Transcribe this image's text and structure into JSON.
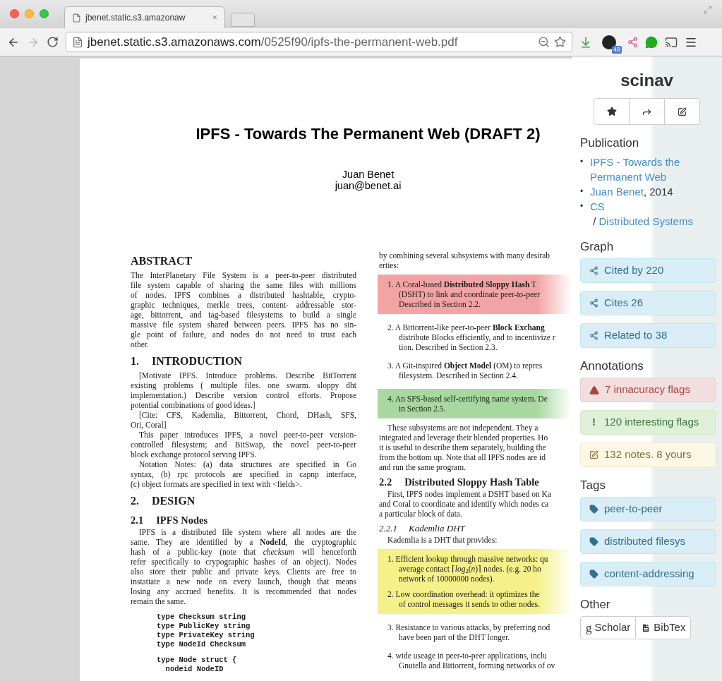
{
  "browser": {
    "tab_title": "jbenet.static.s3.amazonaw",
    "tab_close": "×",
    "url_host": "jbenet.static.s3.amazonaws.com",
    "url_path": "/0525f90/ipfs-the-permanent-web.pdf",
    "extension_badge": "49"
  },
  "document": {
    "title": "IPFS - Towards The Permanent Web (DRAFT 2)",
    "author": "Juan Benet",
    "email": "juan@benet.ai",
    "left_column": [
      {
        "kind": "heading",
        "text": "ABSTRACT"
      },
      {
        "kind": "paragraph",
        "indent": false,
        "lines": [
          "The InterPlanetary File System is a peer-to-peer distributed",
          "file system capable of sharing the same files with millions",
          "of nodes.  IPFS combines a distributed hashtable, crypto-",
          "graphic techniques, merkle trees, content- addressable stor-",
          "age, bittorrent, and tag-based filesystems to build a single",
          "massive file system shared between peers. IPFS has no sin-",
          "gle point of failure, and nodes do not need to trust each",
          "other."
        ]
      },
      {
        "kind": "heading",
        "number": "1.",
        "text": "INTRODUCTION"
      },
      {
        "kind": "paragraph",
        "indent": true,
        "lines": [
          "[Motivate IPFS. Introduce problems. Describe BitTorrent",
          "existing problems ( multiple files. one swarm. sloppy dht",
          "implementation.) Describe version control efforts. Propose",
          "potential combinations of good ideas.]"
        ]
      },
      {
        "kind": "paragraph",
        "indent": true,
        "lines": [
          "[Cite: CFS, Kademlia, Bittorrent, Chord, DHash, SFS,",
          "Ori, Coral]"
        ]
      },
      {
        "kind": "paragraph",
        "indent": true,
        "lines": [
          "This paper introduces IPFS, a novel peer-to-peer version-",
          "controlled filesystem; and BitSwap, the novel peer-to-peer",
          "block exchange protocol serving IPFS."
        ]
      },
      {
        "kind": "paragraph",
        "indent": true,
        "lines": [
          "Notation Notes: (a) data structures are specified in Go",
          "syntax, (b) rpc protocols are specified in capnp interface,",
          "(c) object formats are specified in text with <fields>."
        ]
      },
      {
        "kind": "heading",
        "number": "2.",
        "text": "DESIGN"
      },
      {
        "kind": "subheading",
        "number": "2.1",
        "text": "IPFS Nodes"
      },
      {
        "kind": "paragraph",
        "indent": true,
        "lines": [
          "IPFS is a distributed file system where all nodes are the",
          "same. They are identified by a **NodeId**, the cryptographic",
          "hash of a public-key (note that *checksum* will henceforth",
          "refer specifically to crypographic hashes of an object). Nodes",
          "also store their public and private keys. Clients are free to",
          "instatiate a new node on every launch, though that means",
          "losing any accrued benefits. It is recommended that nodes",
          "remain the same."
        ]
      },
      {
        "kind": "code",
        "lines": [
          "type Checksum string",
          "type PublicKey string",
          "type PrivateKey string",
          "type NodeId Checksum"
        ]
      },
      {
        "kind": "code",
        "lines": [
          "type Node struct {",
          "  nodeid NodeID"
        ]
      }
    ],
    "right_column": [
      {
        "kind": "paragraph",
        "indent": false,
        "lines": [
          "by combining several subsystems with many desirab",
          "erties:"
        ]
      },
      {
        "kind": "list",
        "color": "#f2a3a3",
        "items": [
          {
            "lines": [
              "1. A Coral-based **Distributed Sloppy Hash** T",
              "(DSHT) to link and coordinate peer-to-peer",
              "Described in Section 2.2."
            ]
          }
        ]
      },
      {
        "kind": "list",
        "items": [
          {
            "lines": [
              "2. A Bittorrent-like peer-to-peer **Block Exchang**",
              "distribute Blocks efficiently, and to incentivize r",
              "tion. Described in Section 2.3."
            ]
          },
          {
            "lines": [
              "3. A Git-inspired **Object Model** (OM) to repres",
              "filesystem. Described in Section 2.4."
            ]
          }
        ]
      },
      {
        "kind": "list",
        "color": "#a8d8a0",
        "items": [
          {
            "lines": [
              "4. An SFS-based self-certifying name system. De",
              "in Section 2.5."
            ]
          }
        ]
      },
      {
        "kind": "paragraph",
        "indent": true,
        "lines": [
          "These subsystems are not independent.  They a",
          "integrated and leverage their blended properties. Ho",
          "it is useful to describe them separately, building the",
          "from the bottom up. Note that all IPFS nodes are id",
          "and run the same program."
        ]
      },
      {
        "kind": "subheading",
        "number": "2.2",
        "text": "Distributed Sloppy Hash Table"
      },
      {
        "kind": "paragraph",
        "indent": true,
        "lines": [
          "First, IPFS nodes implement a DSHT based on Ka",
          "and Coral to coordinate and identify which nodes ca",
          "a particular block of data."
        ]
      },
      {
        "kind": "subsubheading",
        "number": "2.2.1",
        "text": "Kademlia DHT"
      },
      {
        "kind": "paragraph",
        "indent": true,
        "lines": [
          "Kademlia is a DHT that provides:"
        ]
      },
      {
        "kind": "list",
        "color": "#f5f08a",
        "items": [
          {
            "lines": [
              "1. Efficient lookup through massive networks: qu",
              "average contact ⌈*log*$_{2}$(*n*)⌉ nodes.  (e.g.  20 ho",
              "network of 10000000 nodes)."
            ]
          },
          {
            "lines": [
              "2. Low coordination overhead: it optimizes the",
              "of control messages it sends to other nodes."
            ]
          }
        ]
      },
      {
        "kind": "list",
        "items": [
          {
            "lines": [
              "3. Resistance to various attacks, by preferring nod",
              "have been part of the DHT longer."
            ]
          },
          {
            "lines": [
              "4. wide useage in peer-to-peer applications, inclu",
              "Gnutella and Bittorrent, forming networks of ov"
            ]
          }
        ]
      }
    ]
  },
  "sidebar": {
    "title": "scinav",
    "actions": [
      {
        "kind": "star"
      },
      {
        "kind": "share"
      },
      {
        "kind": "edit"
      }
    ],
    "sections": [
      {
        "kind": "links",
        "heading": "Publication",
        "items": [
          {
            "marker": "•",
            "parts": [
              {
                "text": "IPFS - Towards the Permanent Web",
                "link": true
              }
            ]
          },
          {
            "marker": "•",
            "parts": [
              {
                "text": "Juan Benet",
                "link": true
              },
              {
                "text": ", 2014",
                "link": false
              }
            ]
          },
          {
            "marker": "•",
            "parts": [
              {
                "text": "CS",
                "link": true
              },
              {
                "text": " / ",
                "link": false
              },
              {
                "text": "Distributed Systems",
                "link": true
              }
            ]
          }
        ]
      },
      {
        "kind": "buttons",
        "heading": "Graph",
        "items": [
          {
            "kind": "graph",
            "label": "Cited by 220"
          },
          {
            "kind": "graph",
            "label": "Cites 26"
          },
          {
            "kind": "graph",
            "label": "Related to 38"
          }
        ]
      },
      {
        "kind": "buttons",
        "heading": "Annotations",
        "items": [
          {
            "kind": "danger",
            "label": "7 innacuracy flags"
          },
          {
            "kind": "success",
            "glyph": "!",
            "label": "120 interesting flags"
          },
          {
            "kind": "warning",
            "label": "132 notes. 8 yours"
          }
        ]
      },
      {
        "kind": "buttons",
        "heading": "Tags",
        "items": [
          {
            "kind": "tag",
            "label": "peer-to-peer"
          },
          {
            "kind": "tag",
            "label": "distributed filesys"
          },
          {
            "kind": "tag",
            "label": "content-addressing"
          }
        ]
      },
      {
        "kind": "group",
        "heading": "Other",
        "items": [
          {
            "kind": "scholar",
            "glyph": "g",
            "label": "Scholar"
          },
          {
            "kind": "bibtex",
            "label": "BibTex"
          }
        ]
      }
    ]
  }
}
